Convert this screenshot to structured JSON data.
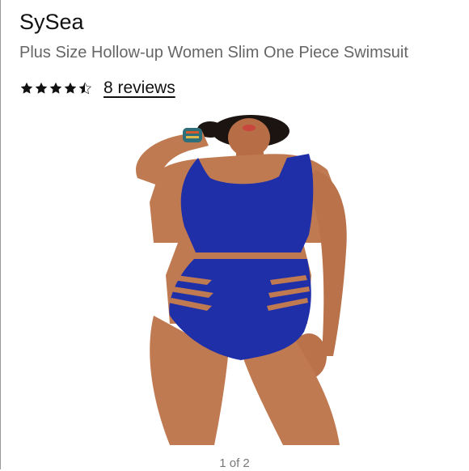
{
  "product": {
    "brand": "SySea",
    "title": "Plus Size Hollow-up Women Slim One Piece Swimsuit",
    "rating": 4.5,
    "reviews_label": "8 reviews"
  },
  "gallery": {
    "pager_label": "1 of 2"
  },
  "colors": {
    "swimsuit": "#1f2fa8",
    "skin": "#c07a52",
    "text_primary": "#111111",
    "text_secondary": "#666666"
  }
}
